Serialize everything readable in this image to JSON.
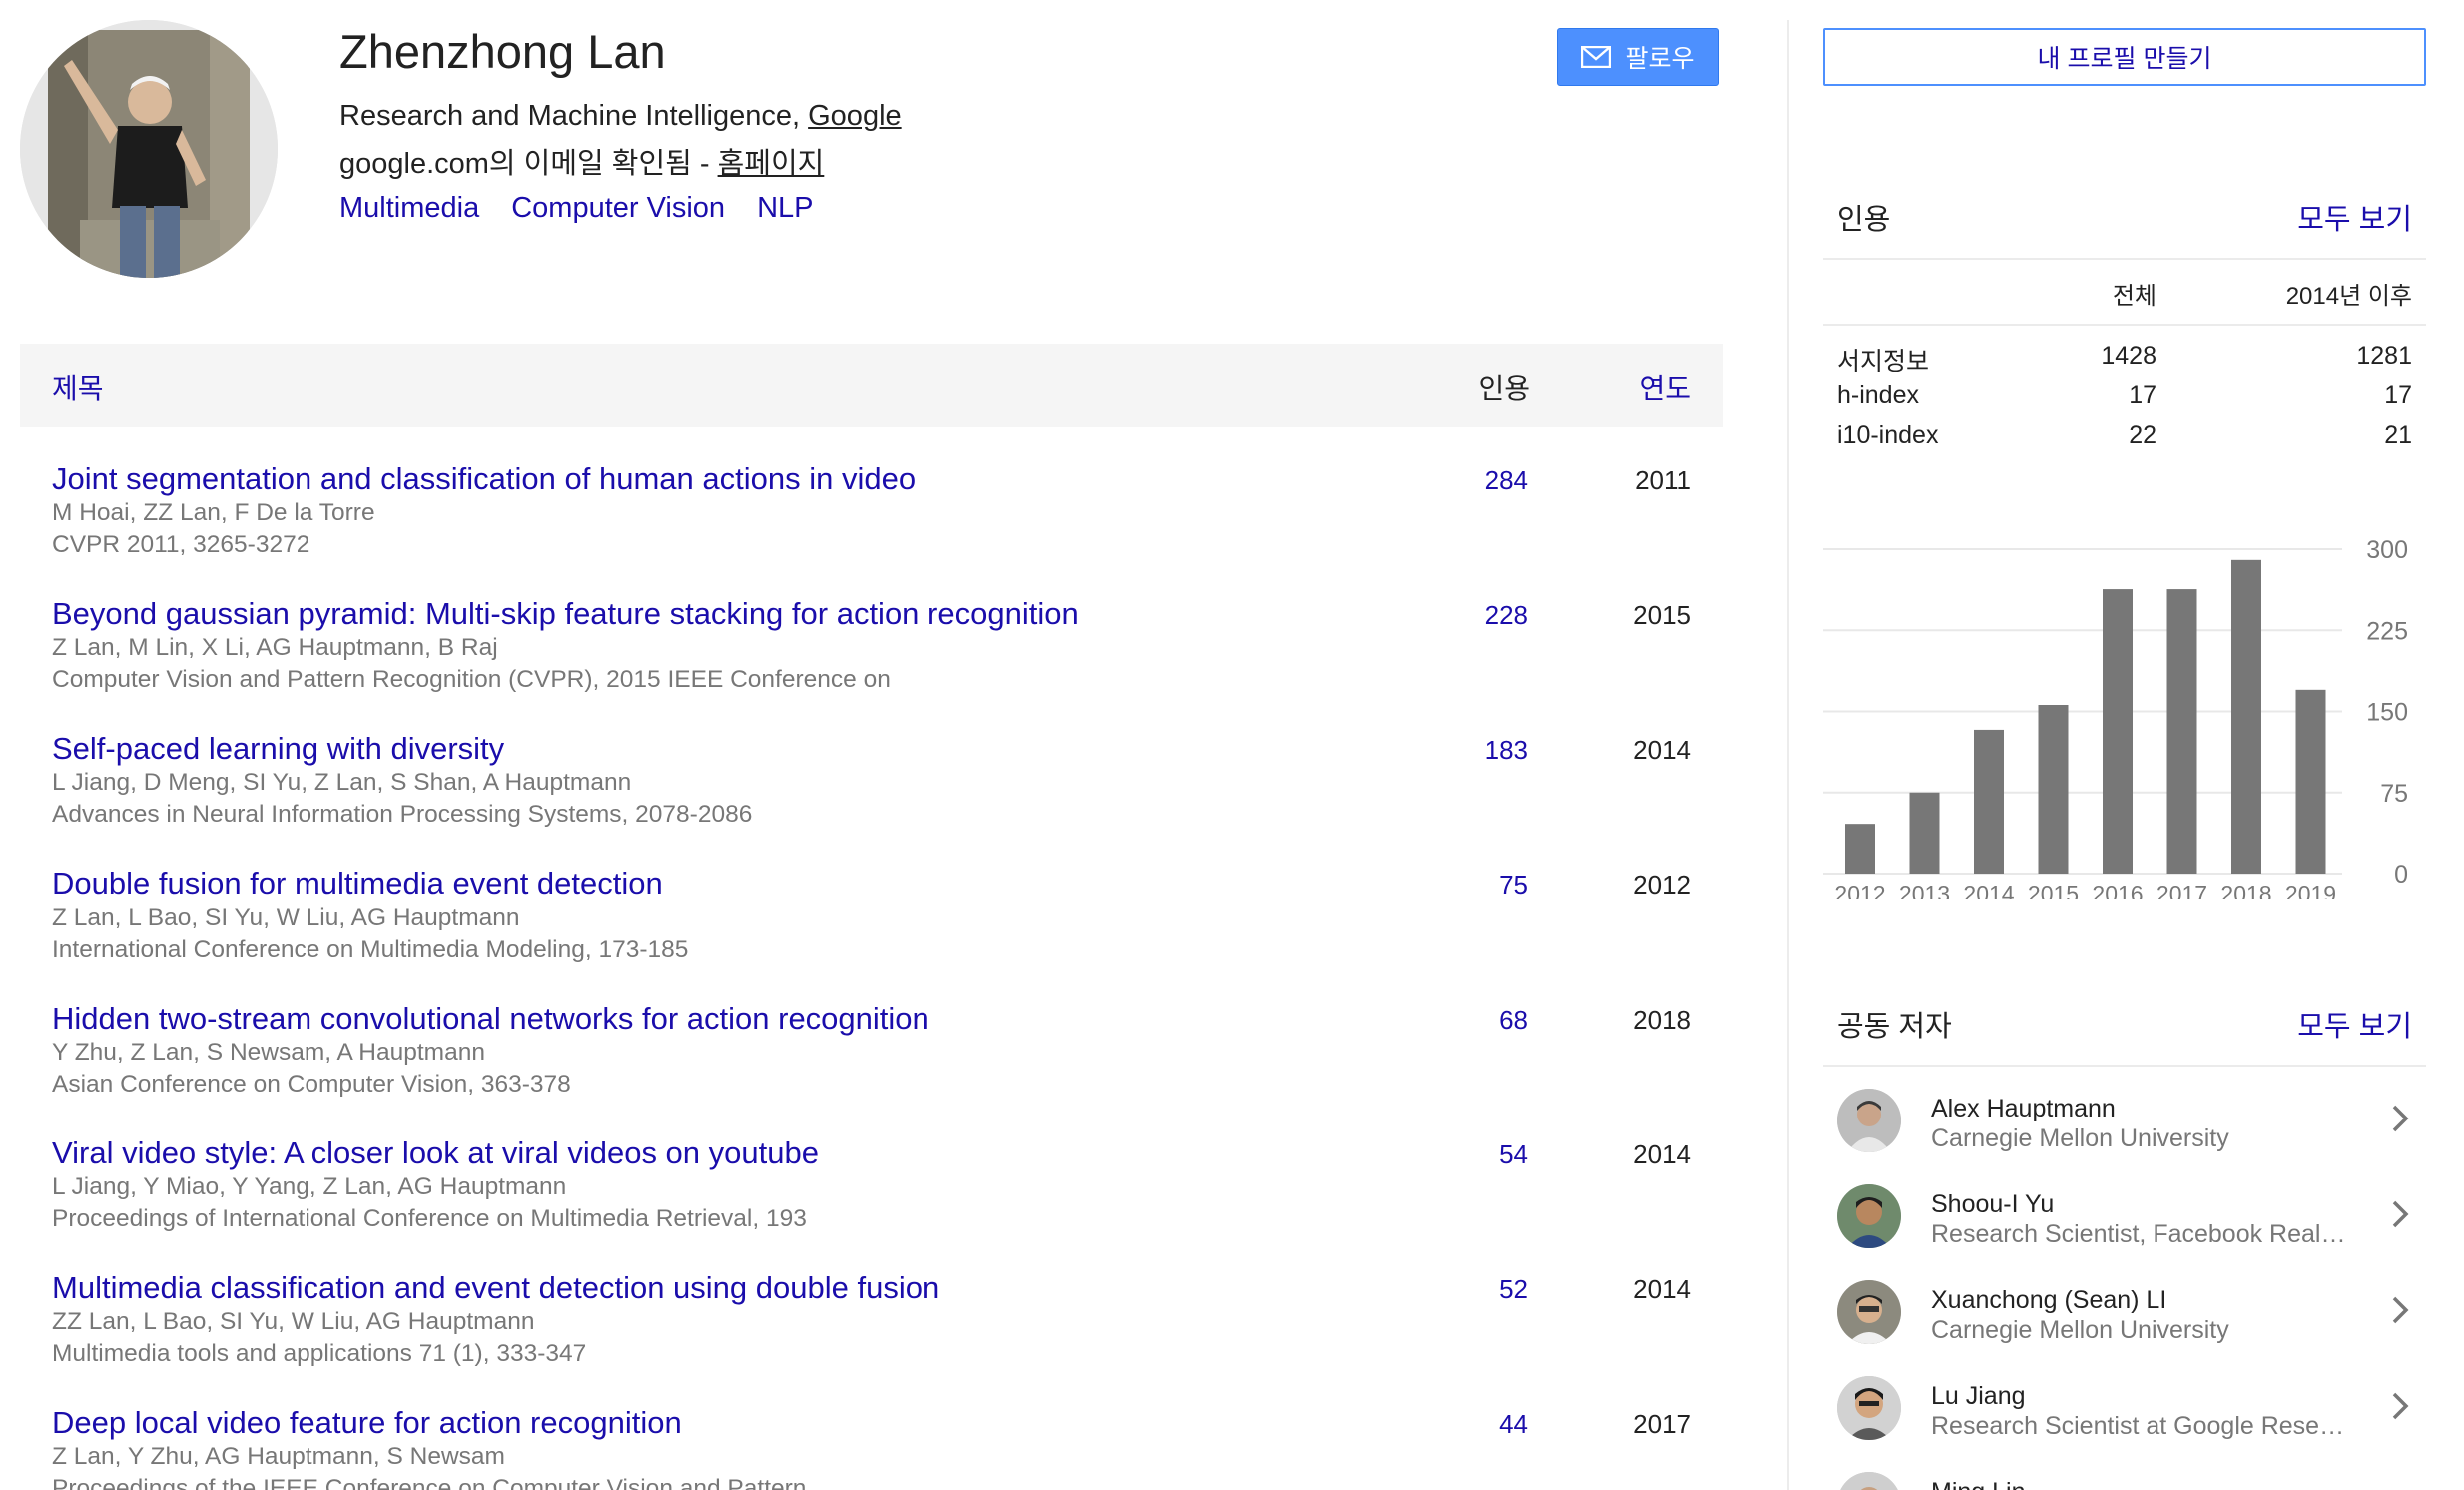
{
  "profile": {
    "name": "Zhenzhong Lan",
    "affiliation_prefix": "Research and Machine Intelligence, ",
    "affiliation_link": "Google",
    "email_text": "google.com의 이메일 확인됨 - ",
    "homepage_link": "홈페이지",
    "interests": [
      "Multimedia",
      "Computer Vision",
      "NLP"
    ],
    "follow_label": "팔로우"
  },
  "table": {
    "header_title": "제목",
    "header_cites": "인용",
    "header_year": "연도",
    "articles": [
      {
        "title": "Joint segmentation and classification of human actions in video",
        "authors": "M Hoai, ZZ Lan, F De la Torre",
        "venue": "CVPR 2011, 3265-3272",
        "cites": "284",
        "year": "2011"
      },
      {
        "title": "Beyond gaussian pyramid: Multi-skip feature stacking for action recognition",
        "authors": "Z Lan, M Lin, X Li, AG Hauptmann, B Raj",
        "venue": "Computer Vision and Pattern Recognition (CVPR), 2015 IEEE Conference on",
        "cites": "228",
        "year": "2015"
      },
      {
        "title": "Self-paced learning with diversity",
        "authors": "L Jiang, D Meng, SI Yu, Z Lan, S Shan, A Hauptmann",
        "venue": "Advances in Neural Information Processing Systems, 2078-2086",
        "cites": "183",
        "year": "2014"
      },
      {
        "title": "Double fusion for multimedia event detection",
        "authors": "Z Lan, L Bao, SI Yu, W Liu, AG Hauptmann",
        "venue": "International Conference on Multimedia Modeling, 173-185",
        "cites": "75",
        "year": "2012"
      },
      {
        "title": "Hidden two-stream convolutional networks for action recognition",
        "authors": "Y Zhu, Z Lan, S Newsam, A Hauptmann",
        "venue": "Asian Conference on Computer Vision, 363-378",
        "cites": "68",
        "year": "2018"
      },
      {
        "title": "Viral video style: A closer look at viral videos on youtube",
        "authors": "L Jiang, Y Miao, Y Yang, Z Lan, AG Hauptmann",
        "venue": "Proceedings of International Conference on Multimedia Retrieval, 193",
        "cites": "54",
        "year": "2014"
      },
      {
        "title": "Multimedia classification and event detection using double fusion",
        "authors": "ZZ Lan, L Bao, SI Yu, W Liu, AG Hauptmann",
        "venue": "Multimedia tools and applications 71 (1), 333-347",
        "cites": "52",
        "year": "2014"
      },
      {
        "title": "Deep local video feature for action recognition",
        "authors": "Z Lan, Y Zhu, AG Hauptmann, S Newsam",
        "venue": "Proceedings of the IEEE Conference on Computer Vision and Pattern …",
        "cites": "44",
        "year": "2017"
      }
    ]
  },
  "sidebar": {
    "make_profile_label": "내 프로필 만들기",
    "citations_title": "인용",
    "view_all": "모두 보기",
    "col_all": "전체",
    "col_since": "2014년 이후",
    "stats": [
      {
        "label": "서지정보",
        "all": "1428",
        "since": "1281"
      },
      {
        "label": "h-index",
        "all": "17",
        "since": "17"
      },
      {
        "label": "i10-index",
        "all": "22",
        "since": "21"
      }
    ],
    "coauthors_title": "공동 저자",
    "coauthors_view_all": "모두 보기",
    "coauthors": [
      {
        "name": "Alex Hauptmann",
        "affiliation": "Carnegie Mellon University"
      },
      {
        "name": "Shoou-I Yu",
        "affiliation": "Research Scientist, Facebook Reality Labs"
      },
      {
        "name": "Xuanchong (Sean) LI",
        "affiliation": "Carnegie Mellon University"
      },
      {
        "name": "Lu Jiang",
        "affiliation": "Research Scientist at Google Research"
      },
      {
        "name": "Ming Lin",
        "affiliation": ""
      }
    ]
  },
  "chart_data": {
    "type": "bar",
    "categories": [
      "2012",
      "2013",
      "2014",
      "2015",
      "2016",
      "2017",
      "2018",
      "2019"
    ],
    "values": [
      46,
      75,
      133,
      156,
      263,
      263,
      290,
      170
    ],
    "ylim": [
      0,
      300
    ],
    "yticks": [
      "0",
      "75",
      "150",
      "225",
      "300"
    ],
    "bar_color": "#777777",
    "grid": true
  }
}
